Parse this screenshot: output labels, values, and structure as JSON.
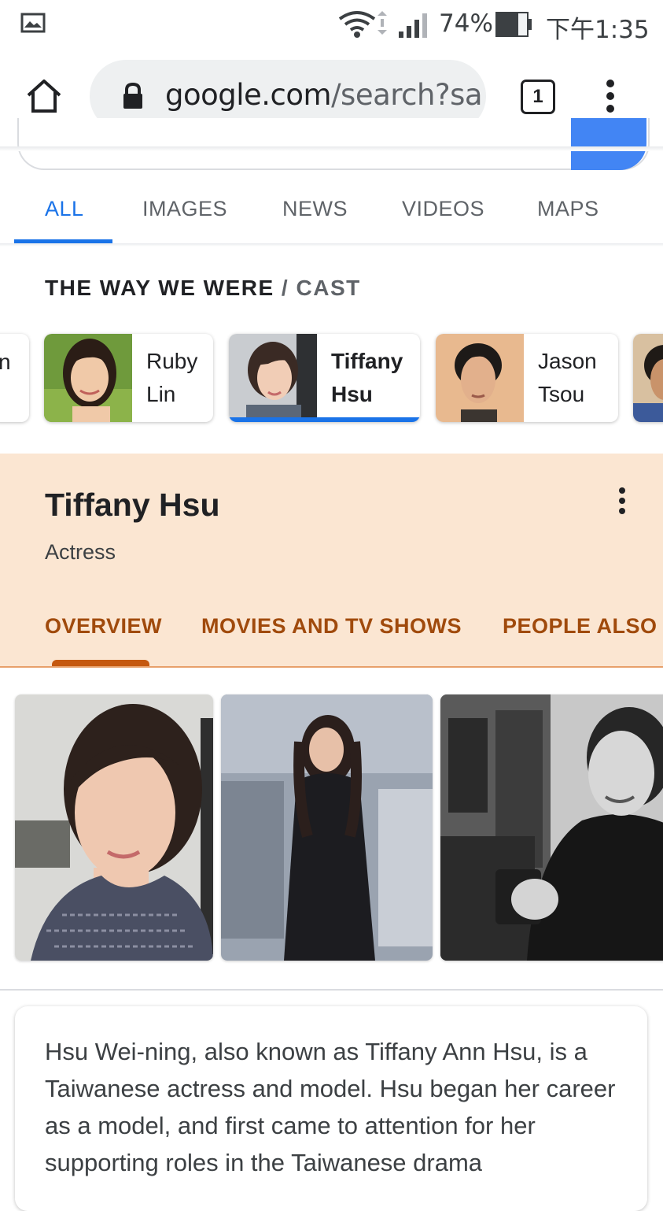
{
  "status_bar": {
    "battery": "74%",
    "time": "下午1:35"
  },
  "browser": {
    "url_host": "google.com",
    "url_path": "/search?sa",
    "tab_count": "1"
  },
  "search_tabs": [
    {
      "label": "ALL",
      "active": true
    },
    {
      "label": "IMAGES"
    },
    {
      "label": "NEWS"
    },
    {
      "label": "VIDEOS"
    },
    {
      "label": "MAPS"
    }
  ],
  "cast_header": {
    "title": "THE WAY WE WERE",
    "separator": " / ",
    "subtitle": "CAST"
  },
  "cast": [
    {
      "partial": "n"
    },
    {
      "name_line1": "Ruby",
      "name_line2": "Lin"
    },
    {
      "name_line1": "Tiffany",
      "name_line2": "Hsu",
      "selected": true
    },
    {
      "name_line1": "Jason",
      "name_line2": "Tsou"
    }
  ],
  "entity": {
    "name": "Tiffany Hsu",
    "type": "Actress",
    "tabs": [
      "OVERVIEW",
      "MOVIES AND TV SHOWS",
      "PEOPLE ALSO S"
    ]
  },
  "description": "Hsu Wei-ning, also known as Tiffany Ann Hsu, is a Taiwanese actress and model. Hsu began her career as a model, and first came to attention for her supporting roles in the Taiwanese drama",
  "colors": {
    "accent": "#1a73e8",
    "panel": "#fbe6d2",
    "panel_tab": "#a04a0c"
  }
}
